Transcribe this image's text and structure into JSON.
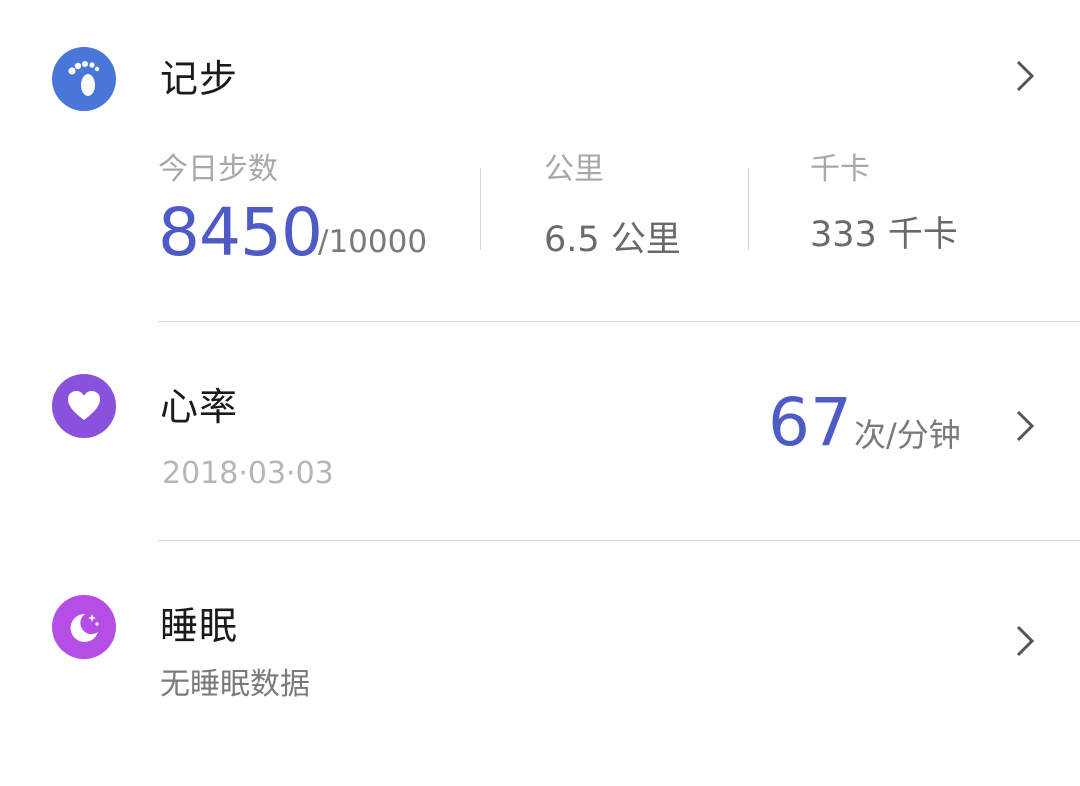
{
  "steps": {
    "title": "记步",
    "icon": "footprint-icon",
    "icon_color": "#4a76d9",
    "today_label": "今日步数",
    "today_value": "8450",
    "goal": "/10000",
    "distance_label": "公里",
    "distance_value": "6.5 公里",
    "calories_label": "千卡",
    "calories_value": "333 千卡"
  },
  "heart_rate": {
    "title": "心率",
    "icon": "heart-icon",
    "icon_color": "#8a52dc",
    "date": "2018·03·03",
    "value": "67",
    "unit": "次/分钟"
  },
  "sleep": {
    "title": "睡眠",
    "icon": "moon-icon",
    "icon_color": "#b44ee6",
    "status": "无睡眠数据"
  },
  "accent_color": "#4e5bc6"
}
